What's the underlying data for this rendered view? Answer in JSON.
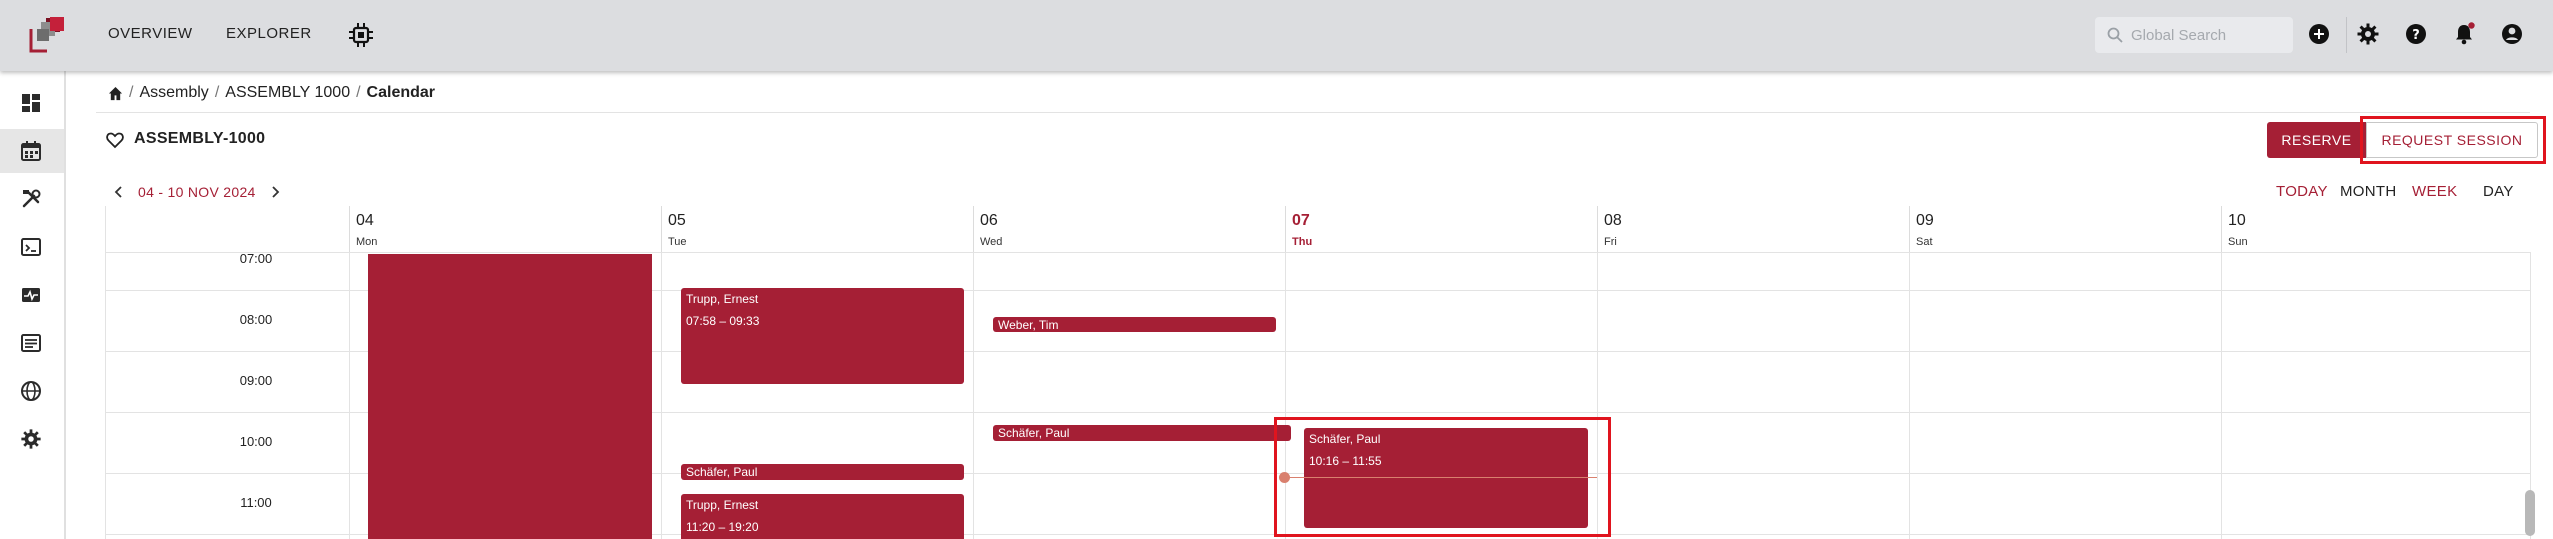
{
  "topbar": {
    "nav": [
      {
        "label": "OVERVIEW"
      },
      {
        "label": "EXPLORER"
      }
    ],
    "search_placeholder": "Global Search",
    "icons": [
      "logo",
      "chip-icon",
      "search-icon",
      "add-circle-icon",
      "gear-icon",
      "help-icon",
      "bell-icon",
      "account-icon"
    ],
    "notification_dot_color": "#a51f35"
  },
  "sidebar": {
    "items": [
      {
        "icon": "dashboard-icon"
      },
      {
        "icon": "calendar-icon",
        "active": true
      },
      {
        "icon": "tools-icon"
      },
      {
        "icon": "terminal-icon"
      },
      {
        "icon": "monitor-icon"
      },
      {
        "icon": "list-icon"
      },
      {
        "icon": "globe-icon"
      },
      {
        "icon": "gear-icon"
      }
    ]
  },
  "breadcrumb": {
    "items": [
      "Assembly",
      "ASSEMBLY 1000"
    ],
    "current": "Calendar",
    "sep": "/"
  },
  "header": {
    "title": "ASSEMBLY-1000",
    "reserve_label": "RESERVE",
    "request_label": "REQUEST SESSION"
  },
  "date_nav": {
    "range": "04 - 10 NOV 2024",
    "views": {
      "today": "TODAY",
      "month": "MONTH",
      "week": "WEEK",
      "day": "DAY"
    }
  },
  "calendar": {
    "days": [
      {
        "num": "04",
        "name": "Mon"
      },
      {
        "num": "05",
        "name": "Tue"
      },
      {
        "num": "06",
        "name": "Wed"
      },
      {
        "num": "07",
        "name": "Thu",
        "today": true
      },
      {
        "num": "08",
        "name": "Fri"
      },
      {
        "num": "09",
        "name": "Sat"
      },
      {
        "num": "10",
        "name": "Sun"
      }
    ],
    "times": [
      "07:00",
      "08:00",
      "09:00",
      "10:00",
      "11:00"
    ],
    "events": [
      {
        "name": "Trupp, Ernest",
        "time": "07:58 – 09:33"
      },
      {
        "name": "Weber, Tim",
        "time": ""
      },
      {
        "name": "Schäfer, Paul",
        "time": ""
      },
      {
        "name": "Schäfer, Paul",
        "time": "10:16 – 11:55"
      },
      {
        "name": "Schäfer, Paul",
        "time": ""
      },
      {
        "name": "Trupp, Ernest",
        "time": "11:20 – 19:20"
      }
    ],
    "accent_color": "#a51f35"
  }
}
